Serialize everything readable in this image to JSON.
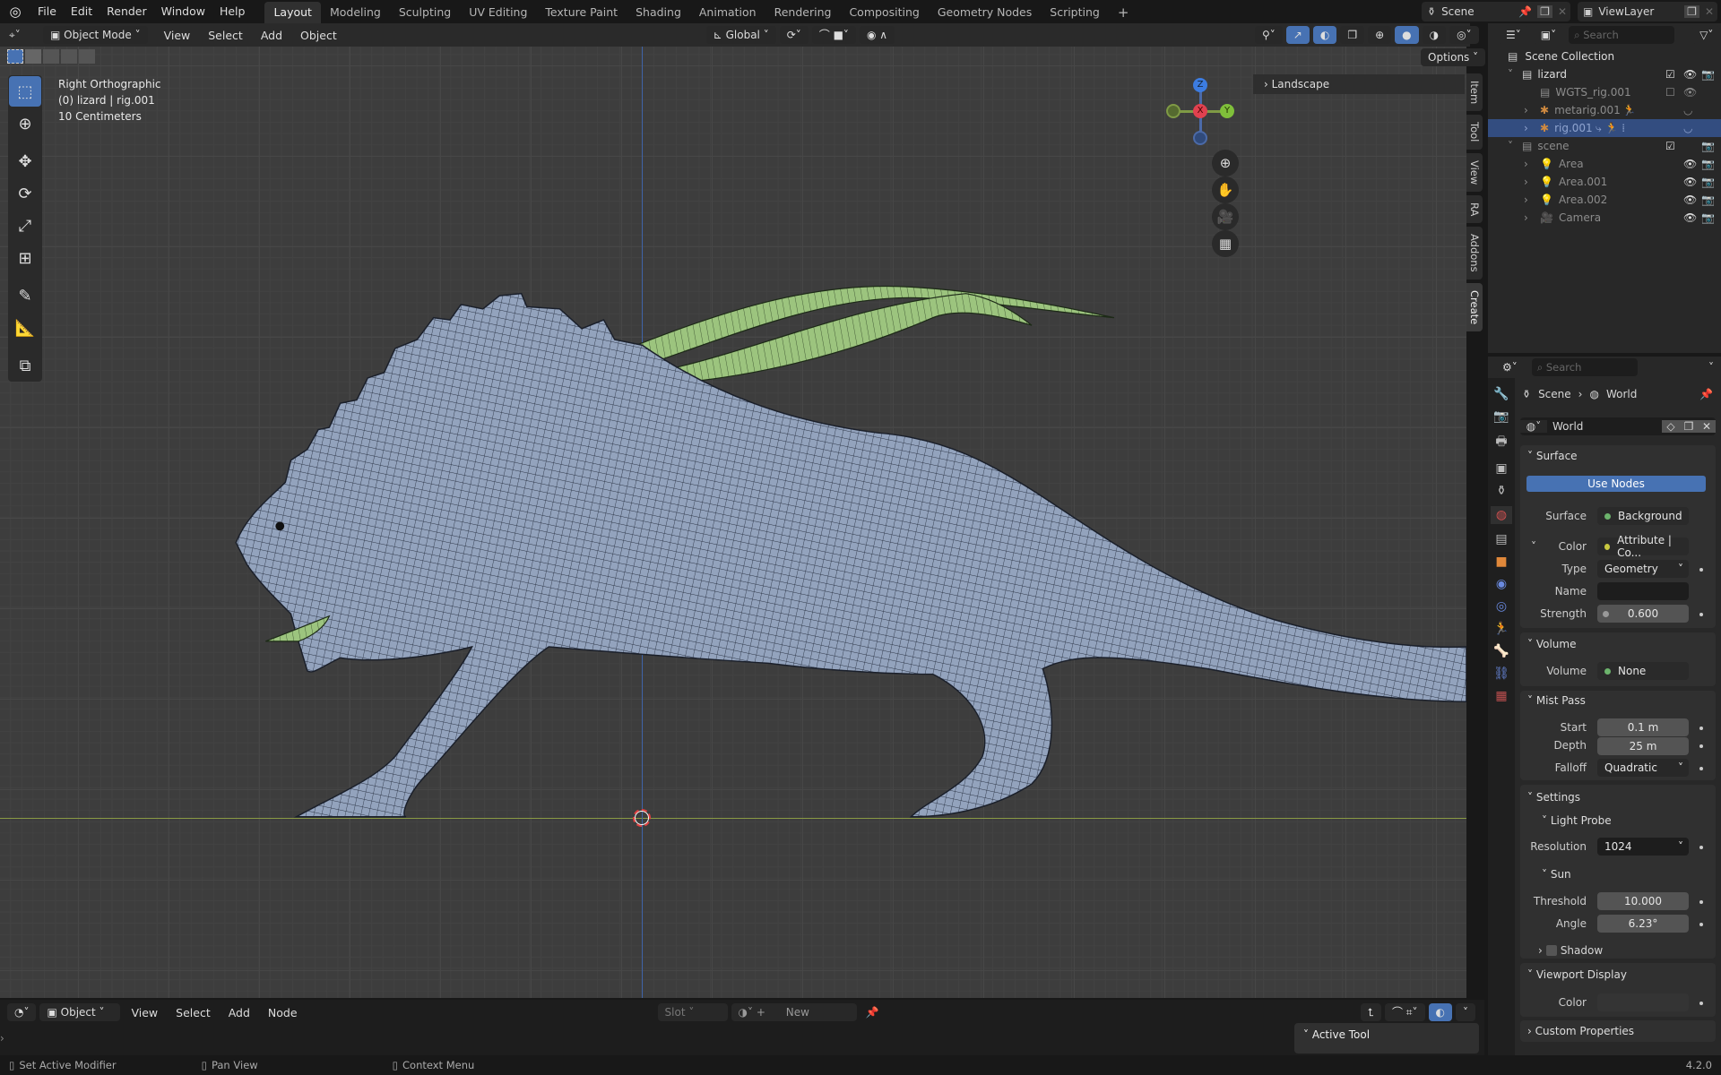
{
  "topbar": {
    "menus": [
      "File",
      "Edit",
      "Render",
      "Window",
      "Help"
    ],
    "workspaces": [
      "Layout",
      "Modeling",
      "Sculpting",
      "UV Editing",
      "Texture Paint",
      "Shading",
      "Animation",
      "Rendering",
      "Compositing",
      "Geometry Nodes",
      "Scripting"
    ],
    "active_workspace": "Layout",
    "add_tab": "+",
    "scene": "Scene",
    "view_layer": "ViewLayer"
  },
  "viewport": {
    "mode": "Object Mode",
    "menus": [
      "View",
      "Select",
      "Add",
      "Object"
    ],
    "orientation": "Global",
    "options": "Options",
    "overlay_text": [
      "Right Orthographic",
      "(0) lizard | rig.001",
      "10 Centimeters"
    ],
    "gizmo_axes": {
      "z": "Z",
      "x": "X",
      "y": "Y"
    },
    "npanel": {
      "section": "Landscape",
      "tabs": [
        "Item",
        "Tool",
        "View",
        "RA",
        "Addons",
        "Create"
      ]
    }
  },
  "outliner": {
    "search_placeholder": "Search",
    "root": "Scene Collection",
    "rows": [
      {
        "name": "lizard",
        "type": "collection"
      },
      {
        "name": "WGTS_rig.001",
        "type": "collection"
      },
      {
        "name": "metarig.001",
        "type": "armature"
      },
      {
        "name": "rig.001",
        "type": "armature",
        "selected": true
      },
      {
        "name": "scene",
        "type": "collection"
      },
      {
        "name": "Area",
        "type": "light"
      },
      {
        "name": "Area.001",
        "type": "light"
      },
      {
        "name": "Area.002",
        "type": "light"
      },
      {
        "name": "Camera",
        "type": "camera"
      }
    ]
  },
  "properties": {
    "search_placeholder": "Search",
    "breadcrumb": [
      "Scene",
      "World"
    ],
    "world_name": "World",
    "surface": {
      "title": "Surface",
      "use_nodes": "Use Nodes",
      "surface_label": "Surface",
      "surface_value": "Background",
      "color_label": "Color",
      "color_value": "Attribute | Co...",
      "type_label": "Type",
      "type_value": "Geometry",
      "name_label": "Name",
      "name_value": "",
      "strength_label": "Strength",
      "strength_value": "0.600"
    },
    "volume": {
      "title": "Volume",
      "label": "Volume",
      "value": "None"
    },
    "mist": {
      "title": "Mist Pass",
      "start_label": "Start",
      "start": "0.1 m",
      "depth_label": "Depth",
      "depth": "25 m",
      "falloff_label": "Falloff",
      "falloff": "Quadratic"
    },
    "settings": {
      "title": "Settings",
      "light_probe": "Light Probe",
      "resolution_label": "Resolution",
      "resolution": "1024",
      "sun": "Sun",
      "threshold_label": "Threshold",
      "threshold": "10.000",
      "angle_label": "Angle",
      "angle": "6.23°",
      "shadow": "Shadow"
    },
    "viewport_display": {
      "title": "Viewport Display",
      "color_label": "Color"
    },
    "custom_properties": "Custom Properties"
  },
  "node_editor": {
    "type": "Object",
    "menus": [
      "View",
      "Select",
      "Add",
      "Node"
    ],
    "slot": "Slot",
    "new": "New",
    "active_tool": "Active Tool"
  },
  "status": {
    "items": [
      "Set Active Modifier",
      "Pan View",
      "Context Menu"
    ],
    "version": "4.2.0"
  },
  "colors": {
    "accent": "#4772b3",
    "selected_row": "#334d80",
    "mesh": "#9aaac4",
    "horn": "#9cc47e"
  }
}
